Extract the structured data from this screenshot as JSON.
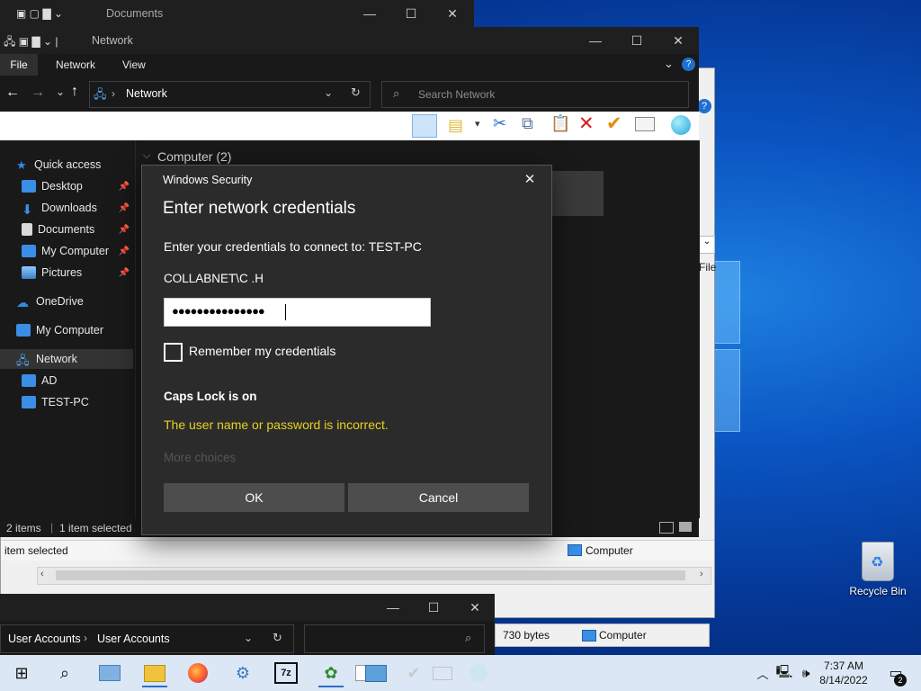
{
  "windows": {
    "documents": {
      "title": "Documents"
    },
    "network": {
      "title": "Network",
      "ribbon_tabs": [
        "File",
        "Network",
        "View"
      ],
      "address": "Network",
      "search_placeholder": "Search Network",
      "group_header": "Computer (2)",
      "nav": {
        "quick_access": "Quick access",
        "desktop": "Desktop",
        "downloads": "Downloads",
        "documents": "Documents",
        "my_computer_pinned": "My Computer",
        "pictures": "Pictures",
        "onedrive": "OneDrive",
        "my_computer": "My Computer",
        "network": "Network",
        "ad": "AD",
        "test_pc": "TEST-PC"
      },
      "status": {
        "items": "2 items",
        "selected": "1 item selected"
      }
    },
    "background_explorer": {
      "status_selected": "item selected",
      "status_location": "Computer",
      "file_size": "730 bytes",
      "location2": "Computer",
      "partial_label": "File"
    },
    "user_accounts": {
      "crumb1": "User Accounts",
      "crumb2": "User Accounts"
    }
  },
  "dialog": {
    "caption": "Windows Security",
    "heading": "Enter network credentials",
    "prompt": "Enter your credentials to connect to: TEST-PC",
    "username": "COLLABNET\\C .H",
    "password_mask": "●●●●●●●●●●●●●●●",
    "remember_label": "Remember my credentials",
    "remember_checked": false,
    "capslock_warning": "Caps Lock is on",
    "error_message": "The user name or password is incorrect.",
    "more_choices": "More choices",
    "ok_label": "OK",
    "cancel_label": "Cancel",
    "error_color": "#e8d21f"
  },
  "desktop": {
    "recycle_bin_label": "Recycle Bin"
  },
  "taskbar": {
    "time": "7:37 AM",
    "date": "8/14/2022",
    "notification_count": "2"
  }
}
